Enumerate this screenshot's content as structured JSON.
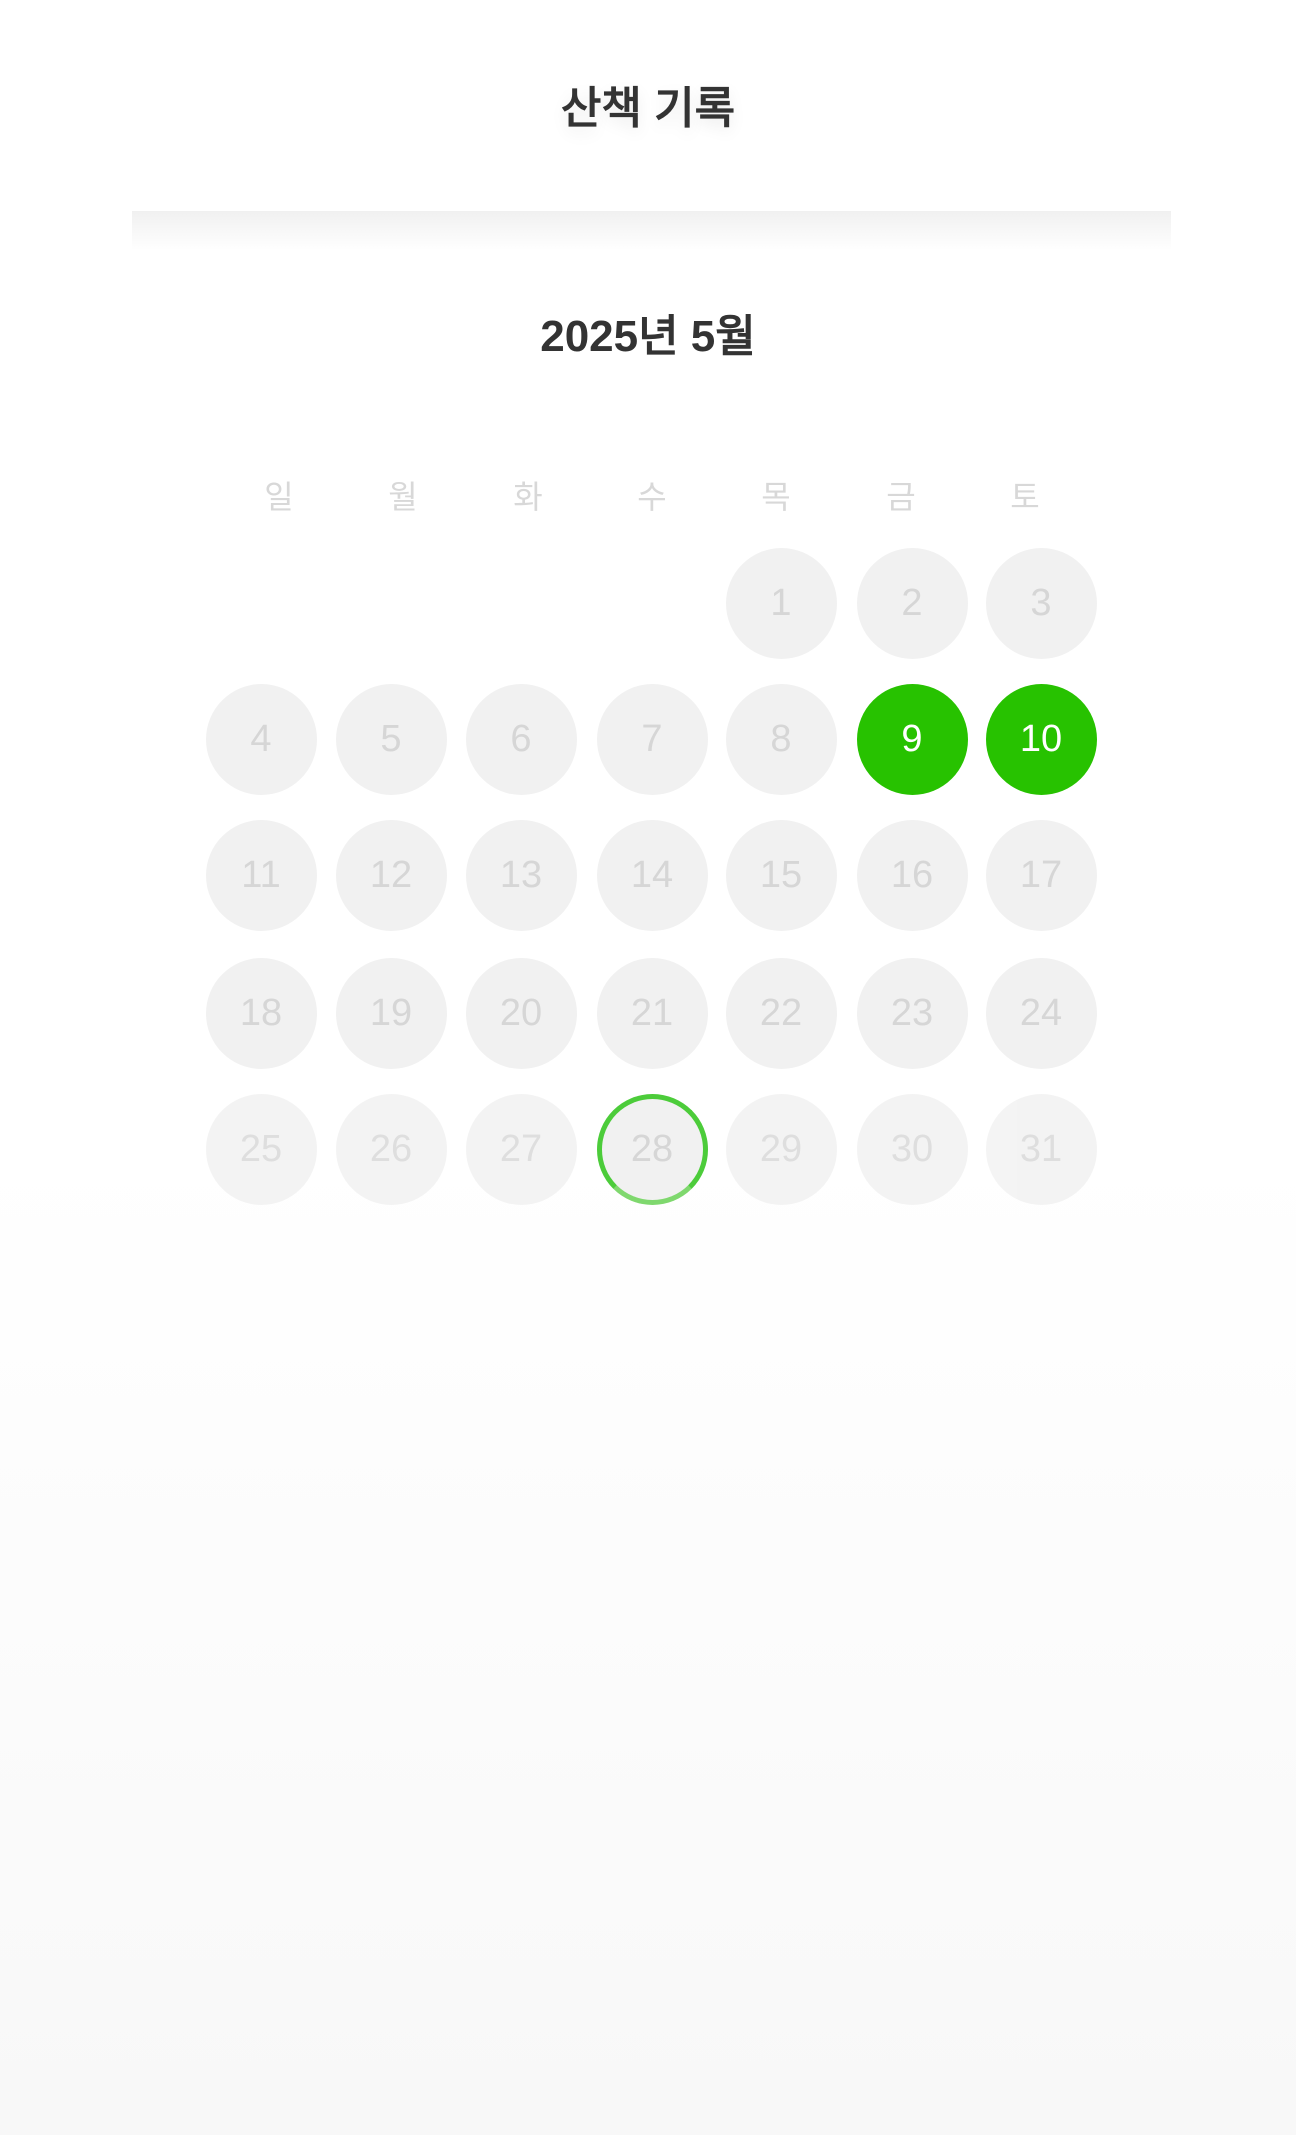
{
  "header": {
    "title": "산책 기록"
  },
  "calendar": {
    "month_label": "2025년 5월",
    "weekdays": [
      "일",
      "월",
      "화",
      "수",
      "목",
      "금",
      "토"
    ],
    "first_weekday_index": 4,
    "days": [
      "1",
      "2",
      "3",
      "4",
      "5",
      "6",
      "7",
      "8",
      "9",
      "10",
      "11",
      "12",
      "13",
      "14",
      "15",
      "16",
      "17",
      "18",
      "19",
      "20",
      "21",
      "22",
      "23",
      "24",
      "25",
      "26",
      "27",
      "28",
      "29",
      "30",
      "31"
    ],
    "walked_days": [
      9,
      10
    ],
    "today": 28,
    "colors": {
      "walked": "#27c200",
      "today_ring": "#4ccc3a",
      "empty": "#f1f1f1",
      "empty_text": "#d6d6d6"
    }
  }
}
